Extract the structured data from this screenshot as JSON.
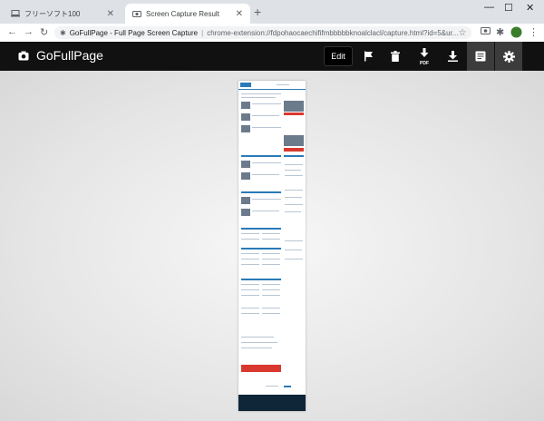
{
  "browser": {
    "tabs": [
      {
        "label": "フリーソフト100",
        "active": false,
        "icon": "laptop-icon"
      },
      {
        "label": "Screen Capture Result",
        "active": true,
        "icon": "camera-icon"
      }
    ],
    "address": {
      "site_name": "GoFullPage - Full Page Screen Capture",
      "url": "chrome-extension://fdpohaocaechififmbbbbbknoalclacl/capture.html?id=5&ur..."
    }
  },
  "app": {
    "name": "GoFullPage",
    "edit_label": "Edit",
    "actions": [
      {
        "name": "flag-icon",
        "label": "Report"
      },
      {
        "name": "trash-icon",
        "label": "Delete"
      },
      {
        "name": "pdf-download-icon",
        "label": "PDF"
      },
      {
        "name": "download-icon",
        "label": "Download"
      },
      {
        "name": "document-icon",
        "label": "Document view"
      },
      {
        "name": "settings-icon",
        "label": "Settings"
      }
    ],
    "pdf_label": "PDF"
  },
  "colors": {
    "appbar": "#111111",
    "accent": "#2a7ab8"
  }
}
